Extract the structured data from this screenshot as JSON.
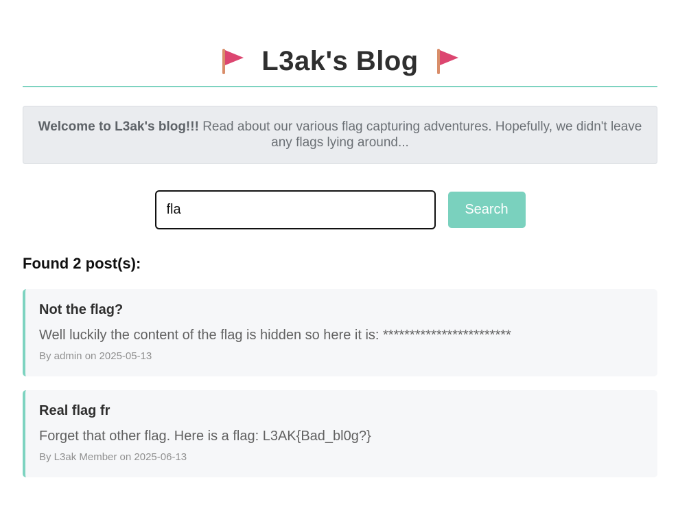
{
  "header": {
    "title": "L3ak's Blog",
    "left_icon": "red-flag-icon",
    "right_icon": "red-flag-icon"
  },
  "welcome": {
    "bold": "Welcome to L3ak's blog!!!",
    "text": " Read about our various flag capturing adventures. Hopefully, we didn't leave any flags lying around..."
  },
  "search": {
    "value": "fla",
    "button_label": "Search"
  },
  "results": {
    "heading": "Found 2 post(s):",
    "posts": [
      {
        "title": "Not the flag?",
        "content": "Well luckily the content of the flag is hidden so here it is: ************************",
        "meta": "By admin on 2025-05-13"
      },
      {
        "title": "Real flag fr",
        "content": "Forget that other flag. Here is a flag: L3AK{Bad_bl0g?}",
        "meta": "By L3ak Member on 2025-06-13"
      }
    ]
  },
  "colors": {
    "accent": "#7dd3c0",
    "button": "#7ad1be",
    "flag": "#dc4670",
    "pole": "#d98e6a"
  }
}
